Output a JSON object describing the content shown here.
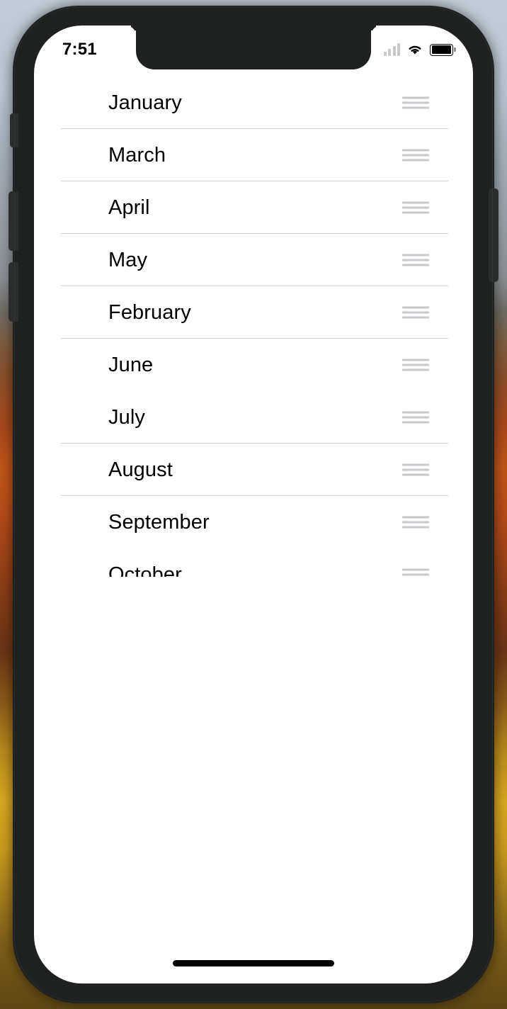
{
  "wallpaper": {
    "description": "autumn-landscape-photo"
  },
  "device": {
    "buttons": {
      "mute_label": "Mute switch",
      "volume_up_label": "Volume up",
      "volume_down_label": "Volume down",
      "power_label": "Side button"
    }
  },
  "status_bar": {
    "time": "7:51",
    "signal_icon": "cellular-signal-icon",
    "signal_bars": 4,
    "signal_active_bars": 0,
    "wifi_icon": "wifi-icon",
    "battery_icon": "battery-icon",
    "battery_level": 100
  },
  "list": {
    "handle_icon": "drag-handle-icon",
    "rows": [
      {
        "label": "January",
        "separator": true
      },
      {
        "label": "March",
        "separator": true
      },
      {
        "label": "April",
        "separator": true
      },
      {
        "label": "May",
        "separator": true
      },
      {
        "label": "February",
        "separator": true
      },
      {
        "label": "June",
        "separator": false
      },
      {
        "label": "July",
        "separator": true
      },
      {
        "label": "August",
        "separator": true
      },
      {
        "label": "September",
        "separator": false
      },
      {
        "label": "October",
        "separator": false
      }
    ]
  },
  "home_indicator": {
    "label": "Home indicator"
  }
}
